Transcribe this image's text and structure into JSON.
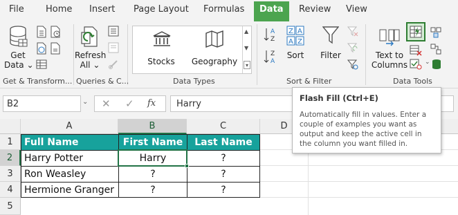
{
  "tabs": [
    "File",
    "Home",
    "Insert",
    "Page Layout",
    "Formulas",
    "Data",
    "Review",
    "View"
  ],
  "active_tab": "Data",
  "ribbon": {
    "get_data": {
      "line1": "Get",
      "line2": "Data ⌄"
    },
    "refresh_all": {
      "line1": "Refresh",
      "line2": "All ⌄"
    },
    "data_types": {
      "stocks": "Stocks",
      "geography": "Geography"
    },
    "sort": "Sort",
    "filter": "Filter",
    "text_to_columns": {
      "line1": "Text to",
      "line2": "Columns"
    },
    "groups": {
      "get_transform": "Get & Transform...",
      "queries": "Queries & C...",
      "data_types": "Data Types",
      "sort_filter": "Sort & Filter",
      "data_tools": "Data Tools"
    }
  },
  "formula_bar": {
    "name_box": "B2",
    "fx": "fx",
    "value": "Harry"
  },
  "sheet": {
    "columns": [
      "A",
      "B",
      "C",
      "D"
    ],
    "rows": [
      "1",
      "2",
      "3",
      "4",
      "5"
    ],
    "headers": [
      "Full Name",
      "First Name",
      "Last Name"
    ],
    "data": [
      [
        "Harry Potter",
        "Harry",
        "?"
      ],
      [
        "Ron Weasley",
        "?",
        "?"
      ],
      [
        "Hermione Granger",
        "?",
        "?"
      ]
    ]
  },
  "tooltip": {
    "title": "Flash Fill (Ctrl+E)",
    "body": "Automatically fill in values. Enter a couple of examples you want as output and keep the active cell in the column you want filled in."
  },
  "colors": {
    "accent": "#4ca44f",
    "header_fill": "#17a29c"
  }
}
